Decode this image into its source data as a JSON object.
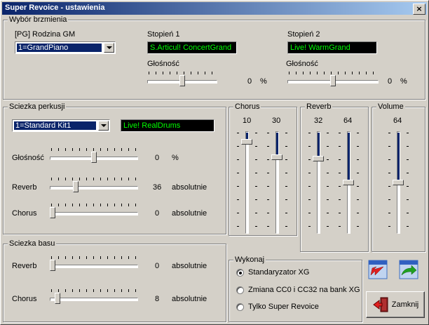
{
  "window": {
    "title": "Super Revoice - ustawienia",
    "close_glyph": "×"
  },
  "brzmienie": {
    "legend": "Wybór brzmienia",
    "rodzina_label": "[PG] Rodzina GM",
    "rodzina_value": "1=GrandPiano",
    "stopien1_label": "Stopień 1",
    "stopien1_value": "S.Articul! ConcertGrand",
    "stopien1_volume_label": "Głośność",
    "stopien1_volume_value": "0",
    "stopien1_volume_unit": "%",
    "stopien1_volume_fraction": 0.5,
    "stopien2_label": "Stopień 2",
    "stopien2_value": "Live! WarmGrand",
    "stopien2_volume_label": "Głośność",
    "stopien2_volume_value": "0",
    "stopien2_volume_unit": "%",
    "stopien2_volume_fraction": 0.5
  },
  "perkusja": {
    "legend": "Sciezka perkusji",
    "kit_value": "1=Standard Kit1",
    "kit_display": "Live! RealDrums",
    "rows": [
      {
        "label": "Głośność",
        "value": "0",
        "unit": "%",
        "fraction": 0.5
      },
      {
        "label": "Reverb",
        "value": "36",
        "unit": "absolutnie",
        "fraction": 0.28
      },
      {
        "label": "Chorus",
        "value": "0",
        "unit": "absolutnie",
        "fraction": 0.0
      }
    ]
  },
  "bas": {
    "legend": "Sciezka basu",
    "rows": [
      {
        "label": "Reverb",
        "value": "0",
        "unit": "absolutnie",
        "fraction": 0.0
      },
      {
        "label": "Chorus",
        "value": "8",
        "unit": "absolutnie",
        "fraction": 0.06
      }
    ]
  },
  "chorus": {
    "legend": "Chorus",
    "values": [
      "10",
      "30"
    ],
    "fractions": [
      0.08,
      0.24
    ]
  },
  "reverb": {
    "legend": "Reverb",
    "values": [
      "32",
      "64"
    ],
    "fractions": [
      0.25,
      0.5
    ]
  },
  "volume": {
    "legend": "Volume",
    "values": [
      "64"
    ],
    "fractions": [
      0.5
    ]
  },
  "wykonaj": {
    "legend": "Wykonaj",
    "options": [
      {
        "label": "Standaryzator XG",
        "selected": true
      },
      {
        "label": "Zmiana CC0 i CC32 na bank XG",
        "selected": false
      },
      {
        "label": "Tylko Super Revoice",
        "selected": false
      }
    ]
  },
  "buttons": {
    "zamknij_label": "Zamknij"
  },
  "colors": {
    "lcd_bg": "#000000",
    "lcd_text": "#00ff00",
    "title_start": "#0a246a",
    "title_end": "#a6caf0",
    "accent": "#0a246a"
  }
}
